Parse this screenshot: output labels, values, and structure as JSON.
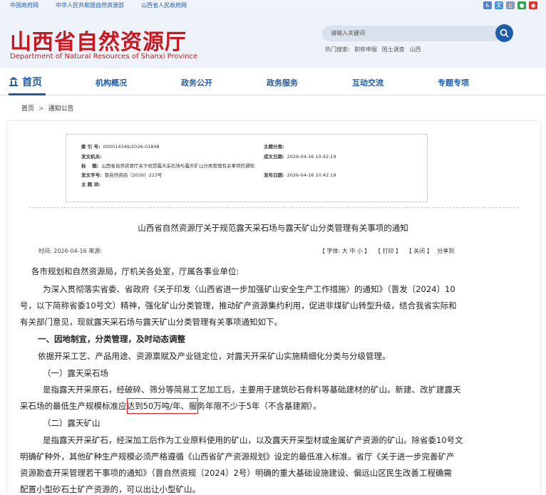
{
  "topbar": {
    "links": [
      "中国政府网",
      "中华人民共和国自然资源部",
      "山西省人民政府网"
    ],
    "icon_colors": [
      "#5b7fbf",
      "#4a90d9",
      "#8a9bb5",
      "#2aa34a",
      "#d9342b"
    ]
  },
  "header": {
    "title_cn": "山西省自然资源厅",
    "title_en": "Department of Natural Resources of Shanxi Province",
    "search_placeholder": "请输入关键词",
    "hot_label": "热门搜索:",
    "hot_items": [
      "职称申报",
      "国土调查",
      "山西"
    ]
  },
  "nav": {
    "home": "首页",
    "items": [
      "机构概况",
      "政务公开",
      "政务服务",
      "互动交流",
      "专题专项"
    ]
  },
  "breadcrumb": {
    "home": "首页",
    "sep": ">",
    "current": "通知公告"
  },
  "meta": {
    "index_label": "索 引 号:",
    "index_value": "000014349/2026-01848",
    "topic_label": "主题分类:",
    "topic_value": "",
    "org_label": "发文机关:",
    "org_value": "",
    "date_label": "成文日期:",
    "date_value": "2026-04-16 10:42:19",
    "title_label": "标　 题:",
    "title_value": "山西省自然资源厅关于规范露天采石场与露天矿山分类管理有关事项的通知",
    "doc_label": "发文字号:",
    "doc_value": "晋自然资函〔2026〕223号",
    "pub_label": "发布日期:",
    "pub_value": "2026-04-16 10:42:19",
    "kw_label": "主 题 词:",
    "kw_value": ""
  },
  "article": {
    "title": "山西省自然资源厅关于规范露天采石场与露天矿山分类管理有关事项的通知",
    "info": "时间:  2026-04-16   来源:",
    "tools": {
      "font": "【 字体:  大  中  小 】",
      "print": "【 打印 】",
      "close": "【 关闭 】",
      "share": "分享到"
    },
    "lines": [
      "各市规划和自然资源局，厅机关各处室，厅属各事业单位:",
      "为深入贯彻落实省委、省政府《关于印发〈山西省进一步加强矿山安全生产工作措施〉的通知》（晋发〔2024〕10",
      "号，以下简称省委10号文）精神，强化矿山分类管理，推动矿产资源集约利用，促进非煤矿山转型升级，结合我省实际和",
      "有关部门意见，现就露天采石场与露天矿山分类管理有关事项通知如下。",
      "一、因地制宜，分类管理，及时动态调整",
      "依据开采工艺、产品用途、资源禀赋及产业链定位，对露天开采矿山实施精细化分类与分级管理。",
      "（一）露天采石场",
      "是指露天开采原石，经破碎、筛分等简易工艺加工后，主要用于建筑砂石骨料等基础建材的矿山。新建、改扩建露天",
      "采石场的最低生产规模标准应达到50万吨/年、服务年限不少于5年（不含基建期）。",
      "（二）露天矿山",
      "是指露天开采矿石，经深加工后作为工业原料使用的矿山，以及露天开采型材或金属矿产资源的矿山。除省委10号文",
      "明确矿种外，其他矿种生产规模必须严格遵循《山西省矿产资源规划》设定的最低准入标准。省厅《关于进一步完善矿产",
      "资源勘查开采管理若干事项的通知》（晋自然资规〔2024〕2号）明确的重大基础设施建设、偏远山区民生改善工程确需",
      "配置小型砂石土矿产资源的，可以出让小型矿山。"
    ]
  }
}
